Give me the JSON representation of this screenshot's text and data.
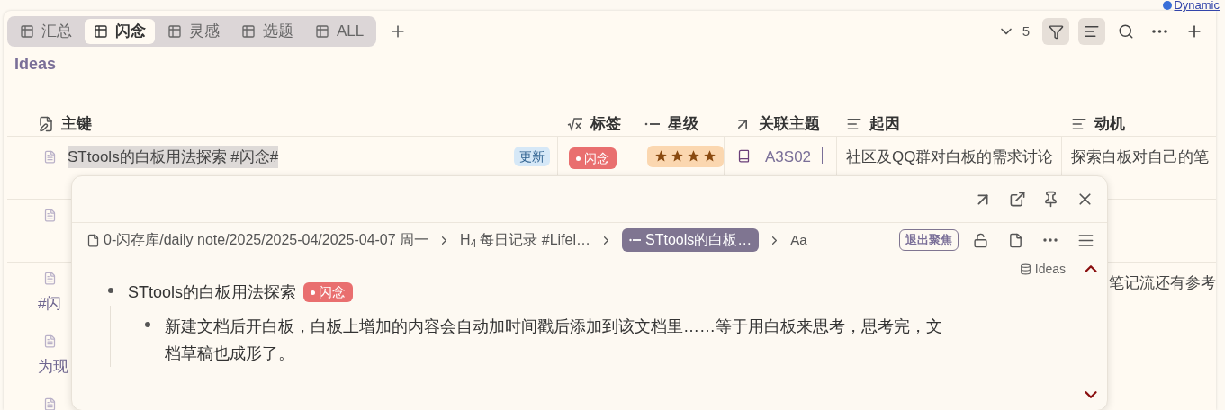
{
  "top_link": "Dynamic",
  "tabs": [
    {
      "label": "汇总",
      "selected": false
    },
    {
      "label": "闪念",
      "selected": true
    },
    {
      "label": "灵感",
      "selected": false
    },
    {
      "label": "选题",
      "selected": false
    },
    {
      "label": "ALL",
      "selected": false
    }
  ],
  "toolbar": {
    "count": "5",
    "filter_on": true,
    "sort_on": true
  },
  "view_title": "Ideas",
  "columns": [
    {
      "label": "主键",
      "kind": "key"
    },
    {
      "label": "标签",
      "kind": "formula"
    },
    {
      "label": "星级",
      "kind": "select"
    },
    {
      "label": "关联主题",
      "kind": "relation"
    },
    {
      "label": "起因",
      "kind": "text"
    },
    {
      "label": "动机",
      "kind": "text"
    }
  ],
  "rows": [
    {
      "title": "STtools的白板用法探索 #闪念#",
      "badge": "更新",
      "tag": "闪念",
      "stars": 4,
      "related": "A3S02",
      "cause": "社区及QQ群对白板的需求讨论",
      "motive": "探索白板对自己的笔"
    },
    {},
    {
      "title_cont": "#闪",
      "motive": "笔记流还有参考"
    },
    {
      "title_cont": "为现"
    },
    {}
  ],
  "popup": {
    "breadcrumb": [
      {
        "kind": "file",
        "label": "0-闪存库/daily note/2025/2025-04/2025-04-07 周一"
      },
      {
        "kind": "heading",
        "marker": "H$_{4}$",
        "label": "每日记录 #Lifel…"
      },
      {
        "kind": "block",
        "label": "STtools的白板…"
      }
    ],
    "font_button": "Aa",
    "exit_focus": "退出聚焦",
    "db_label": "Ideas",
    "blocks": [
      {
        "text": "STtools的白板用法探索",
        "tag": "闪念",
        "children": [
          {
            "text": "新建文档后开白板，白板上增加的内容会自动加时间戳后添加到该文档里……等于用白板来思考，思考完，文档草稿也成形了。"
          }
        ]
      }
    ]
  }
}
